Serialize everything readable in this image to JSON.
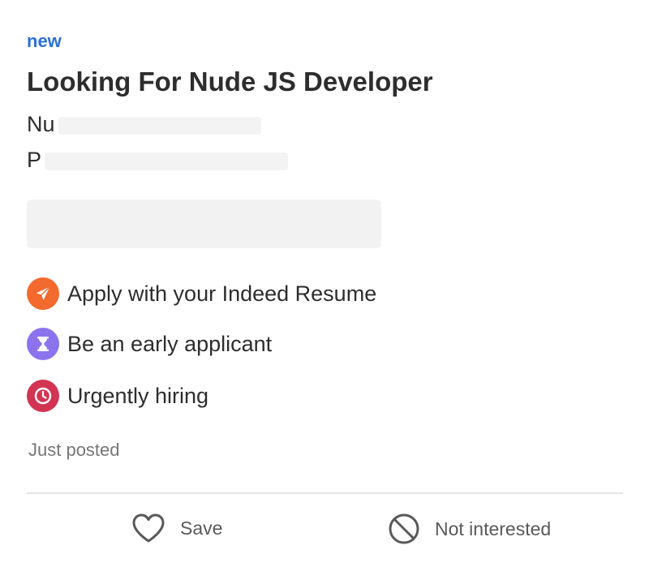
{
  "job": {
    "badge": "new",
    "title": "Looking For Nude JS Developer",
    "company_visible": "Nu",
    "location_visible": "P"
  },
  "features": [
    {
      "label": "Apply with your Indeed Resume",
      "icon": "paper-plane-icon",
      "color": "#f26a2e"
    },
    {
      "label": "Be an early applicant",
      "icon": "hourglass-icon",
      "color": "#8c73ee"
    },
    {
      "label": "Urgently hiring",
      "icon": "clock-icon",
      "color": "#d23553"
    }
  ],
  "posted": "Just posted",
  "actions": {
    "save_label": "Save",
    "not_interested_label": "Not interested"
  }
}
